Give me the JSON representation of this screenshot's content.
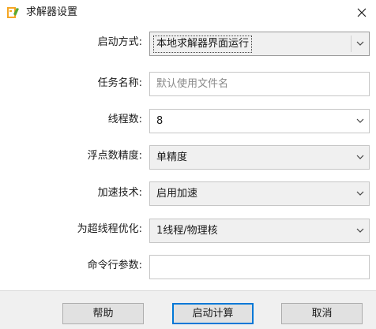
{
  "window": {
    "title": "求解器设置",
    "close_glyph": "✕"
  },
  "form": {
    "startup_label": "启动方式:",
    "startup_value": "本地求解器界面运行",
    "task_name_label": "任务名称:",
    "task_name_placeholder": "默认使用文件名",
    "threads_label": "线程数:",
    "threads_value": "8",
    "precision_label": "浮点数精度:",
    "precision_value": "单精度",
    "accel_label": "加速技术:",
    "accel_value": "启用加速",
    "hyperthread_label": "为超线程优化:",
    "hyperthread_value": "1线程/物理核",
    "cmdline_label": "命令行参数:",
    "cmdline_value": ""
  },
  "buttons": {
    "help": "帮助",
    "start": "启动计算",
    "cancel": "取消"
  },
  "colors": {
    "accent": "#0078d7",
    "icon_orange": "#f5a623",
    "icon_green": "#5aa832"
  },
  "icons": {
    "app": "solver-app-icon",
    "close": "close-icon",
    "dropdown": "chevron-down-icon"
  }
}
